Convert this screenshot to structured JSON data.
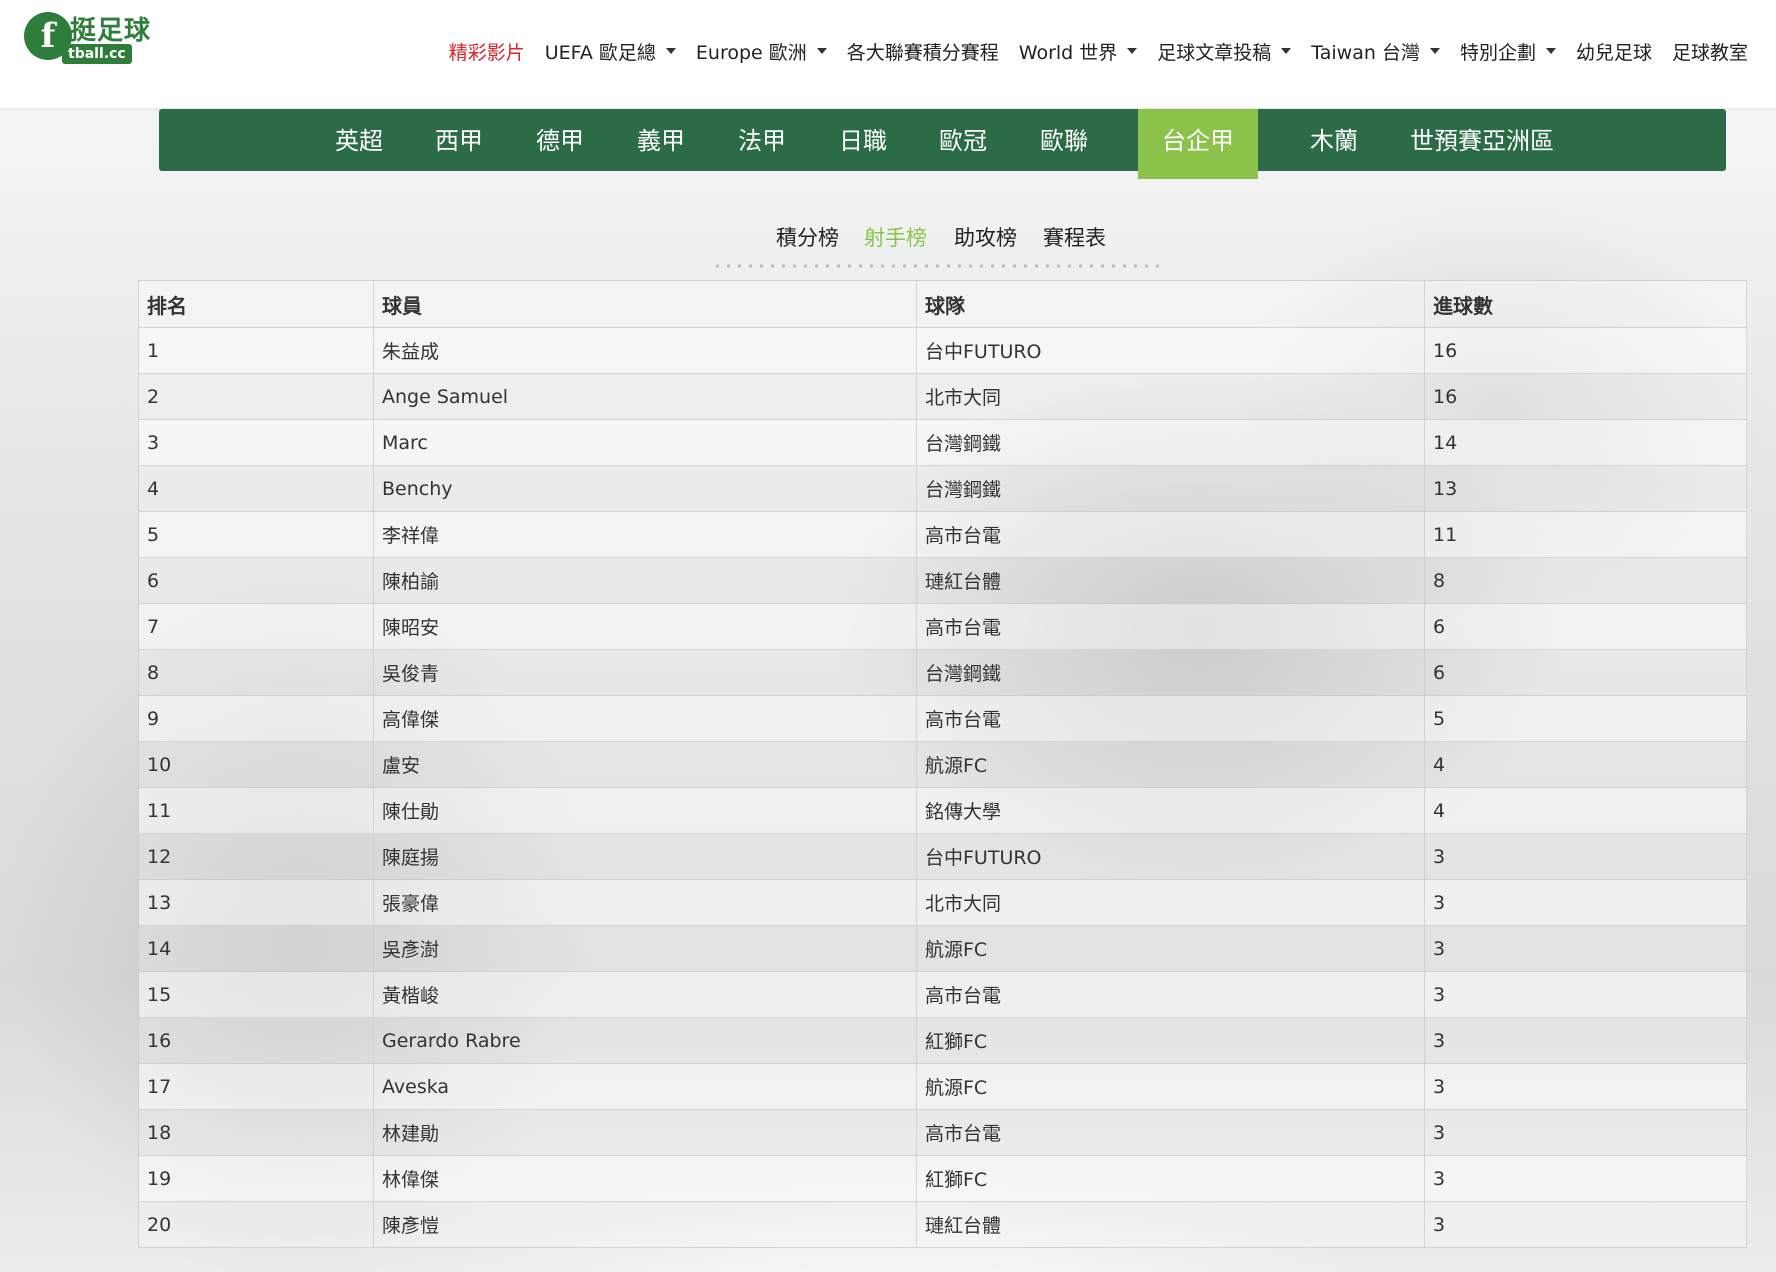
{
  "logo": {
    "mark": "f",
    "cn": "挺足球",
    "en": "tball.cc"
  },
  "topnav": [
    {
      "label": "精彩影片",
      "dropdown": false,
      "active": true
    },
    {
      "label": "UEFA 歐足總",
      "dropdown": true
    },
    {
      "label": "Europe 歐洲",
      "dropdown": true
    },
    {
      "label": "各大聯賽積分賽程",
      "dropdown": false
    },
    {
      "label": "World 世界",
      "dropdown": true
    },
    {
      "label": "足球文章投稿",
      "dropdown": true
    },
    {
      "label": "Taiwan 台灣",
      "dropdown": true
    },
    {
      "label": "特別企劃",
      "dropdown": true
    },
    {
      "label": "幼兒足球",
      "dropdown": false
    },
    {
      "label": "足球教室",
      "dropdown": false
    }
  ],
  "leagues": [
    "英超",
    "西甲",
    "德甲",
    "義甲",
    "法甲",
    "日職",
    "歐冠",
    "歐聯",
    "台企甲",
    "木蘭",
    "世預賽亞洲區"
  ],
  "league_active": "台企甲",
  "subtabs": [
    "積分榜",
    "射手榜",
    "助攻榜",
    "賽程表"
  ],
  "subtab_active": "射手榜",
  "table": {
    "headers": [
      "排名",
      "球員",
      "球隊",
      "進球數"
    ],
    "rows": [
      [
        "1",
        "朱益成",
        "台中FUTURO",
        "16"
      ],
      [
        "2",
        "Ange Samuel",
        "北市大同",
        "16"
      ],
      [
        "3",
        "Marc",
        "台灣鋼鐵",
        "14"
      ],
      [
        "4",
        "Benchy",
        "台灣鋼鐵",
        "13"
      ],
      [
        "5",
        "李祥偉",
        "高市台電",
        "11"
      ],
      [
        "6",
        "陳柏諭",
        "璉紅台體",
        "8"
      ],
      [
        "7",
        "陳昭安",
        "高市台電",
        "6"
      ],
      [
        "8",
        "吳俊青",
        "台灣鋼鐵",
        "6"
      ],
      [
        "9",
        "高偉傑",
        "高市台電",
        "5"
      ],
      [
        "10",
        "盧安",
        "航源FC",
        "4"
      ],
      [
        "11",
        "陳仕勛",
        "銘傳大學",
        "4"
      ],
      [
        "12",
        "陳庭揚",
        "台中FUTURO",
        "3"
      ],
      [
        "13",
        "張豪偉",
        "北市大同",
        "3"
      ],
      [
        "14",
        "吳彥澍",
        "航源FC",
        "3"
      ],
      [
        "15",
        "黃楷峻",
        "高市台電",
        "3"
      ],
      [
        "16",
        "Gerardo Rabre",
        "紅獅FC",
        "3"
      ],
      [
        "17",
        "Aveska",
        "航源FC",
        "3"
      ],
      [
        "18",
        "林建勛",
        "高市台電",
        "3"
      ],
      [
        "19",
        "林偉傑",
        "紅獅FC",
        "3"
      ],
      [
        "20",
        "陳彥愷",
        "璉紅台體",
        "3"
      ]
    ]
  },
  "colors": {
    "brand_green": "#2b6b47",
    "active_green": "#8bc34a",
    "active_red": "#d8242a"
  }
}
